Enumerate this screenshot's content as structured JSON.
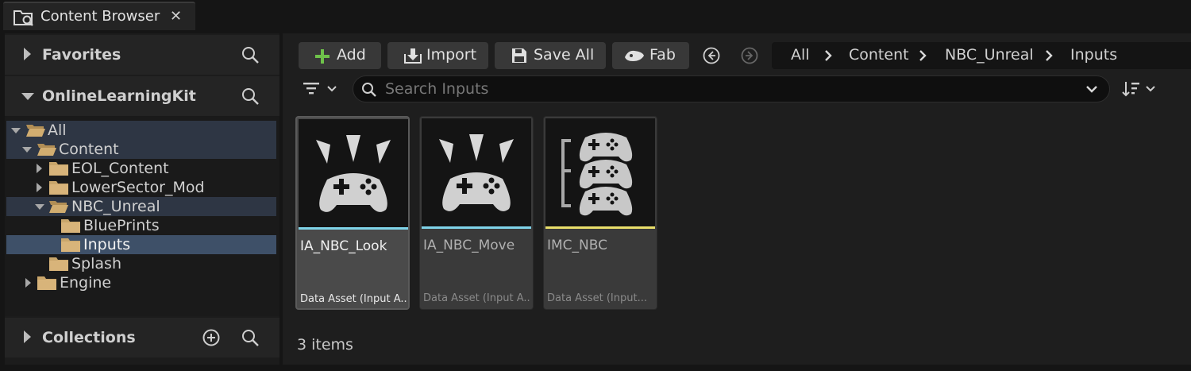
{
  "tab": {
    "title": "Content Browser",
    "close": "✕"
  },
  "sidebar": {
    "favorites": {
      "label": "Favorites"
    },
    "project": {
      "label": "OnlineLearningKit"
    },
    "collections": {
      "label": "Collections"
    },
    "tree": [
      {
        "label": "All"
      },
      {
        "label": "Content"
      },
      {
        "label": "EOL_Content"
      },
      {
        "label": "LowerSector_Mod"
      },
      {
        "label": "NBC_Unreal"
      },
      {
        "label": "BluePrints"
      },
      {
        "label": "Inputs"
      },
      {
        "label": "Splash"
      },
      {
        "label": "Engine"
      }
    ]
  },
  "toolbar": {
    "add": "Add",
    "import": "Import",
    "save_all": "Save All",
    "fab": "Fab"
  },
  "breadcrumb": [
    "All",
    "Content",
    "NBC_Unreal",
    "Inputs"
  ],
  "search": {
    "placeholder": "Search Inputs"
  },
  "assets": [
    {
      "name": "IA_NBC_Look",
      "type": "Data Asset (Input A...",
      "stripe": "#7fd3e8"
    },
    {
      "name": "IA_NBC_Move",
      "type": "Data Asset (Input A...",
      "stripe": "#7fd3e8"
    },
    {
      "name": "IMC_NBC",
      "type": "Data Asset (Input...",
      "stripe": "#e8de6a"
    }
  ],
  "status": {
    "count": "3 items"
  },
  "colors": {
    "accent_green": "#6ec24a",
    "folder": "#c9a66b",
    "selection": "#3e5068"
  }
}
